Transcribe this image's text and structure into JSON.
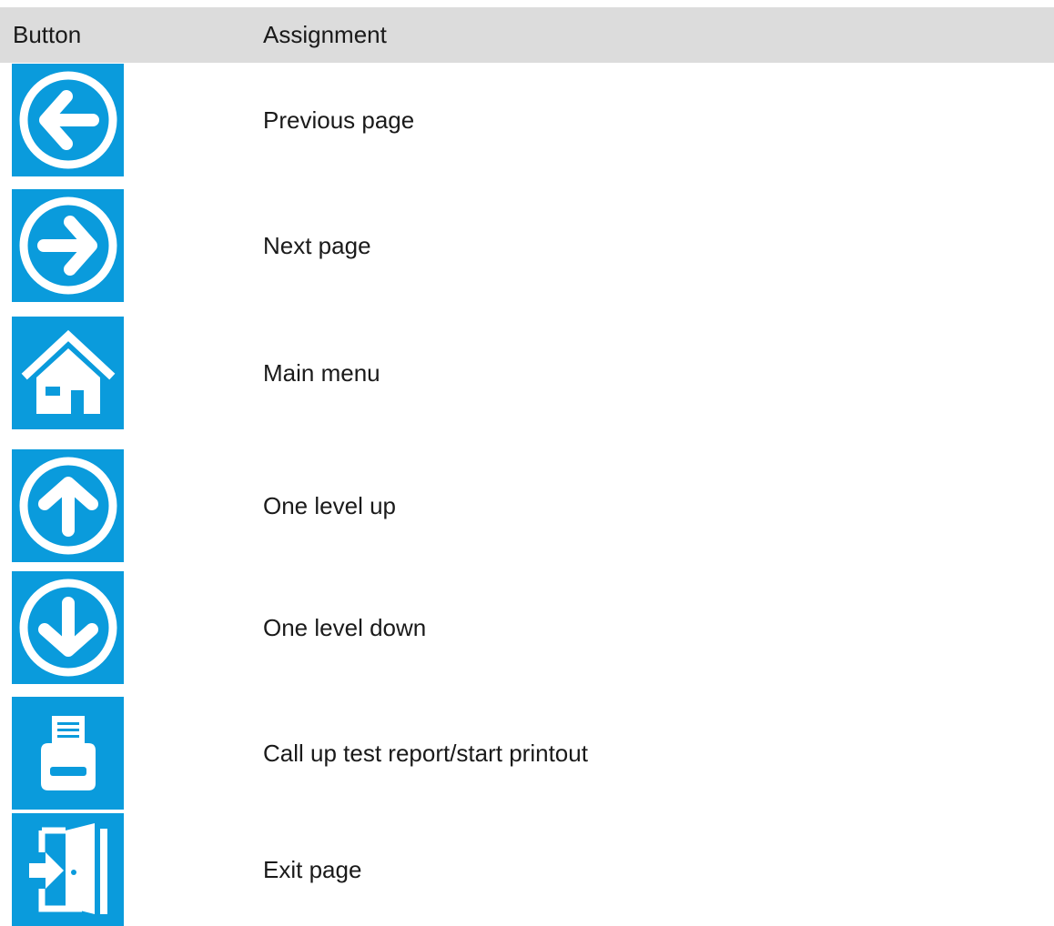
{
  "header": {
    "button_col": "Button",
    "assignment_col": "Assignment"
  },
  "accent_color": "#0a9bdc",
  "rows": [
    {
      "icon": "arrow-left-circle-icon",
      "label": "Previous page"
    },
    {
      "icon": "arrow-right-circle-icon",
      "label": "Next page"
    },
    {
      "icon": "home-icon",
      "label": "Main menu"
    },
    {
      "icon": "arrow-up-circle-icon",
      "label": "One level up"
    },
    {
      "icon": "arrow-down-circle-icon",
      "label": "One level down"
    },
    {
      "icon": "printer-icon",
      "label": "Call up test report/start printout"
    },
    {
      "icon": "exit-door-icon",
      "label": "Exit page"
    }
  ]
}
